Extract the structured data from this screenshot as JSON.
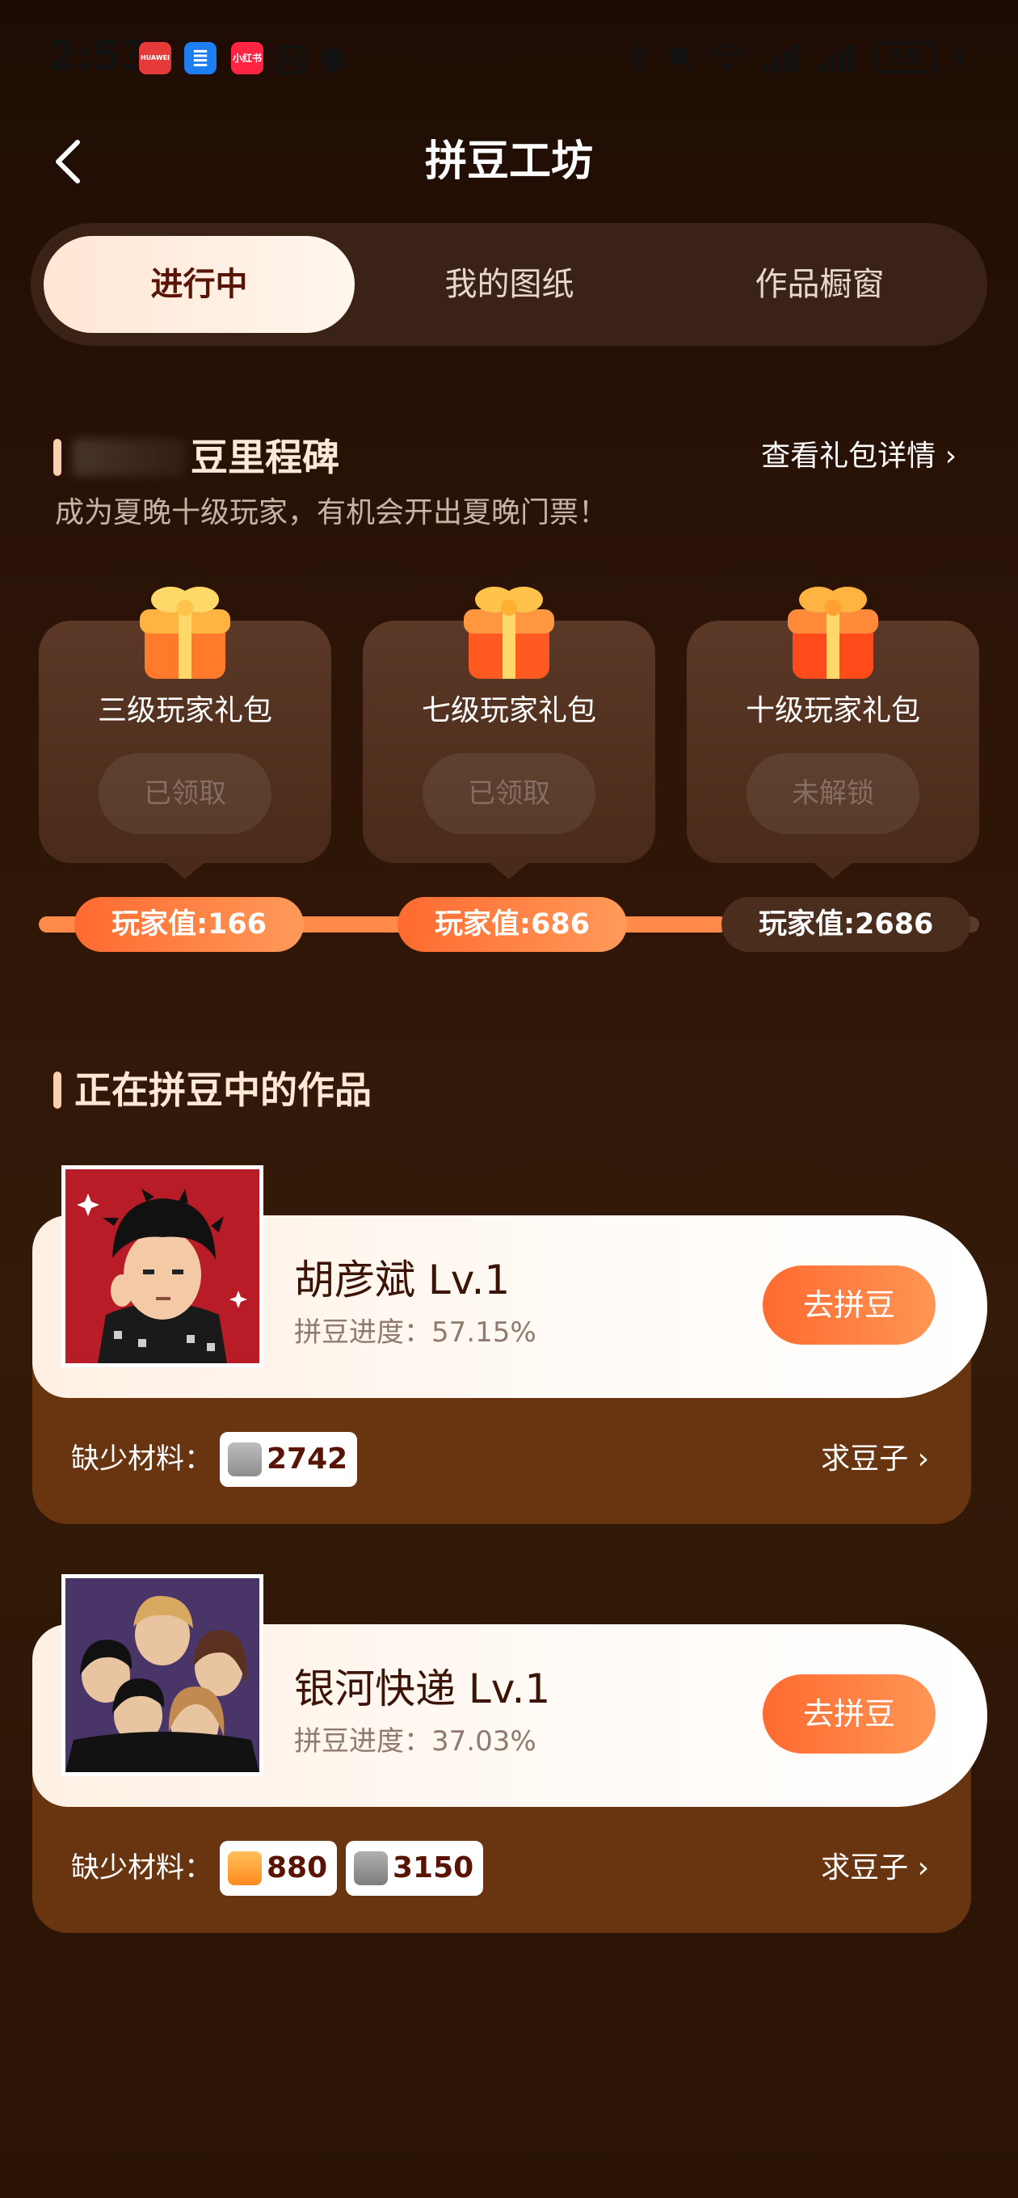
{
  "status_bar": {
    "time": "2:53",
    "app_icons": [
      {
        "name": "huawei",
        "label": "HUAWEI",
        "color": "#e63a3a"
      },
      {
        "name": "reader",
        "label": "≣",
        "color": "#1c7ef0"
      },
      {
        "name": "xiaohongshu",
        "label": "小红书",
        "color": "#ff2442"
      }
    ],
    "battery": "55"
  },
  "header": {
    "title": "拼豆工坊"
  },
  "tabs": [
    {
      "label": "进行中",
      "active": true
    },
    {
      "label": "我的图纸",
      "active": false
    },
    {
      "label": "作品橱窗",
      "active": false
    }
  ],
  "milestone": {
    "title": "豆里程碑",
    "details_link": "查看礼包详情 ›",
    "subtitle": "成为夏晚十级玩家，有机会开出夏晚门票！",
    "gifts": [
      {
        "name": "三级玩家礼包",
        "button": "已领取",
        "points": "玩家值:166",
        "reached": true
      },
      {
        "name": "七级玩家礼包",
        "button": "已领取",
        "points": "玩家值:686",
        "reached": true
      },
      {
        "name": "十级玩家礼包",
        "button": "未解锁",
        "points": "玩家值:2686",
        "reached": false
      }
    ]
  },
  "works_section": {
    "title": "正在拼豆中的作品",
    "works": [
      {
        "name": "胡彦斌 Lv.1",
        "progress": "拼豆进度：57.15%",
        "button": "去拼豆",
        "missing_label": "缺少材料：",
        "materials": [
          {
            "color": "#9a9a9a",
            "count": "2742"
          }
        ],
        "ask_link": "求豆子 ›"
      },
      {
        "name": "银河快递 Lv.1",
        "progress": "拼豆进度：37.03%",
        "button": "去拼豆",
        "missing_label": "缺少材料：",
        "materials": [
          {
            "color": "#ff9a30",
            "count": "880"
          },
          {
            "color": "#8e8e8e",
            "count": "3150"
          }
        ],
        "ask_link": "求豆子 ›"
      }
    ]
  },
  "colors": {
    "accent": "#ff7a3c",
    "card_light": "#fff3ea",
    "card_brown": "#683510",
    "background": "#2c1407"
  }
}
